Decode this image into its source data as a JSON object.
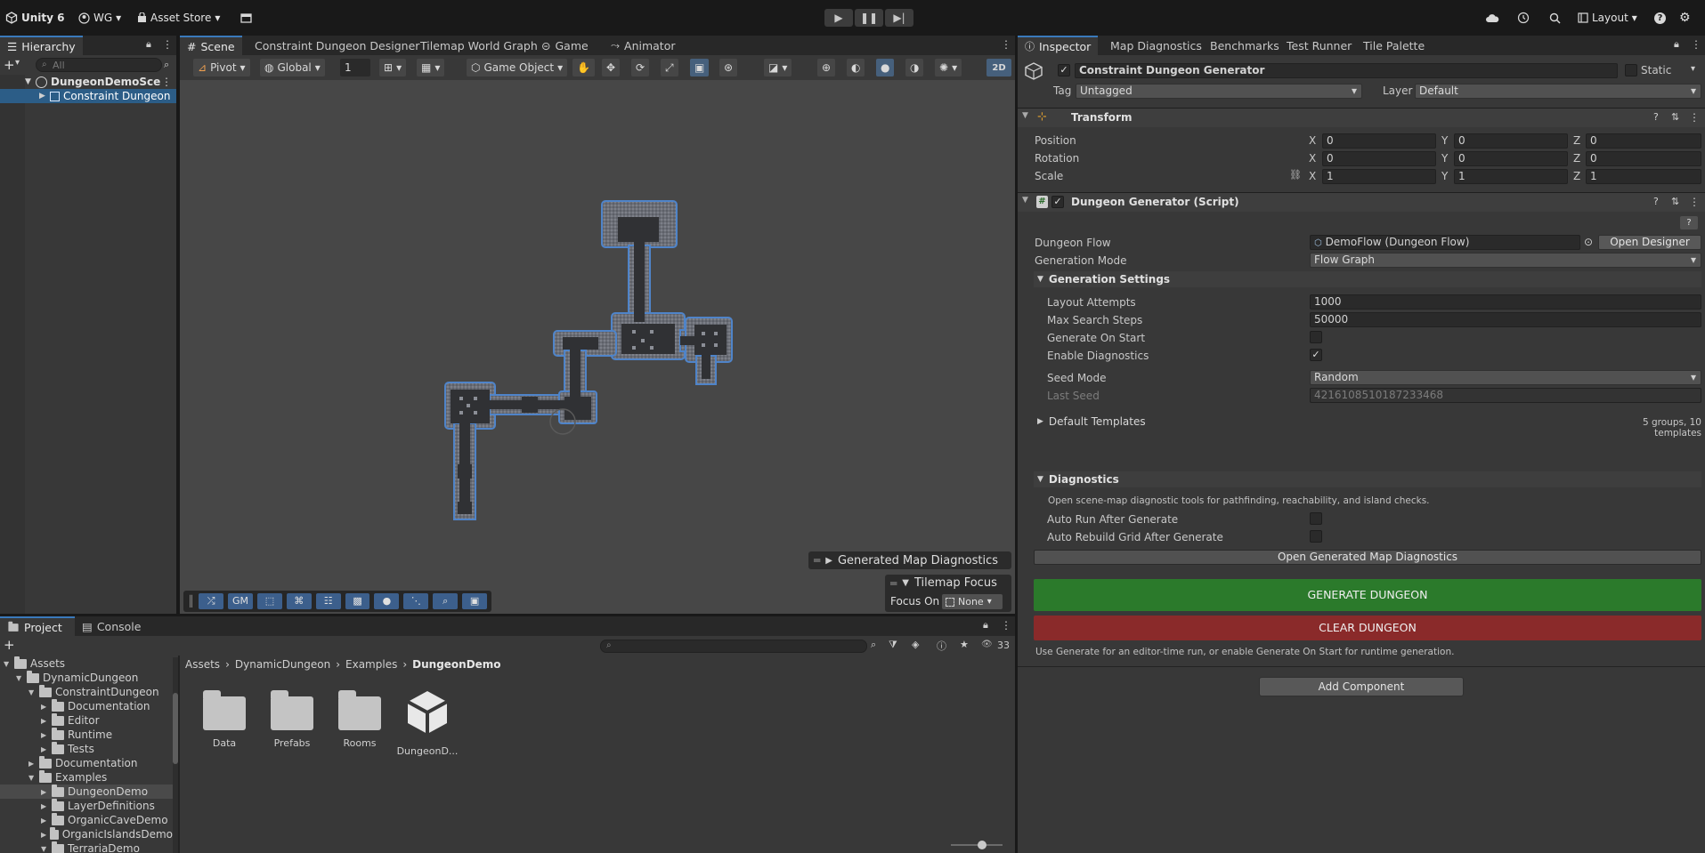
{
  "toolbar": {
    "app_name": "Unity 6",
    "account": "WG",
    "asset_store": "Asset Store",
    "layout": "Layout"
  },
  "hierarchy": {
    "tab": "Hierarchy",
    "search_placeholder": "All",
    "scene_name": "DungeonDemoScene",
    "object_name": "Constraint Dungeon G"
  },
  "scene": {
    "tabs": [
      "Scene",
      "Constraint Dungeon Designer",
      "Tilemap World Graph",
      "Game",
      "Animator"
    ],
    "pivot": "Pivot",
    "global": "Global",
    "grid_value": "1",
    "game_object": "Game Object",
    "mode_2d": "2D",
    "overlay_diagnostics": "Generated Map Diagnostics",
    "overlay_tilemap_focus": "Tilemap Focus",
    "focus_on_label": "Focus On",
    "focus_on_value": "None",
    "gm_label": "GM"
  },
  "inspector": {
    "tabs": [
      "Inspector",
      "Map Diagnostics",
      "Benchmarks",
      "Test Runner",
      "Tile Palette"
    ],
    "object_name": "Constraint Dungeon Generator",
    "static_label": "Static",
    "tag_label": "Tag",
    "tag_value": "Untagged",
    "layer_label": "Layer",
    "layer_value": "Default",
    "transform": {
      "title": "Transform",
      "position_label": "Position",
      "rotation_label": "Rotation",
      "scale_label": "Scale",
      "position": [
        "0",
        "0",
        "0"
      ],
      "rotation": [
        "0",
        "0",
        "0"
      ],
      "scale": [
        "1",
        "1",
        "1"
      ]
    },
    "script": {
      "title": "Dungeon Generator (Script)",
      "dungeon_flow_label": "Dungeon Flow",
      "dungeon_flow_value": "DemoFlow (Dungeon Flow)",
      "open_designer": "Open Designer",
      "generation_mode_label": "Generation Mode",
      "generation_mode_value": "Flow Graph",
      "generation_settings": "Generation Settings",
      "layout_attempts_label": "Layout Attempts",
      "layout_attempts_value": "1000",
      "max_search_label": "Max Search Steps",
      "max_search_value": "50000",
      "generate_on_start_label": "Generate On Start",
      "enable_diag_label": "Enable Diagnostics",
      "seed_mode_label": "Seed Mode",
      "seed_mode_value": "Random",
      "last_seed_label": "Last Seed",
      "last_seed_value": "4216108510187233468",
      "default_templates": "Default Templates",
      "templates_summary": "5 groups, 10 templates",
      "diagnostics": "Diagnostics",
      "diag_description": "Open scene-map diagnostic tools for pathfinding, reachability, and island checks.",
      "auto_run_label": "Auto Run After Generate",
      "auto_rebuild_label": "Auto Rebuild Grid After Generate",
      "open_diag_button": "Open Generated Map Diagnostics",
      "generate_button": "GENERATE DUNGEON",
      "clear_button": "CLEAR DUNGEON",
      "footer_hint": "Use Generate for an editor-time run, or enable Generate On Start for runtime generation."
    },
    "add_component": "Add Component"
  },
  "project": {
    "tabs": [
      "Project",
      "Console"
    ],
    "count": "33",
    "tree": [
      {
        "label": "Assets",
        "depth": 0,
        "open": true
      },
      {
        "label": "DynamicDungeon",
        "depth": 1,
        "open": true
      },
      {
        "label": "ConstraintDungeon",
        "depth": 2,
        "open": true
      },
      {
        "label": "Documentation",
        "depth": 3,
        "open": false
      },
      {
        "label": "Editor",
        "depth": 3,
        "open": false
      },
      {
        "label": "Runtime",
        "depth": 3,
        "open": false
      },
      {
        "label": "Tests",
        "depth": 3,
        "open": false
      },
      {
        "label": "Documentation",
        "depth": 2,
        "open": false
      },
      {
        "label": "Examples",
        "depth": 2,
        "open": true
      },
      {
        "label": "DungeonDemo",
        "depth": 3,
        "open": false
      },
      {
        "label": "LayerDefinitions",
        "depth": 3,
        "open": false
      },
      {
        "label": "OrganicCaveDemo",
        "depth": 3,
        "open": false
      },
      {
        "label": "OrganicIslandsDemo",
        "depth": 3,
        "open": false
      },
      {
        "label": "TerrariaDemo",
        "depth": 3,
        "open": true
      }
    ],
    "breadcrumb": [
      "Assets",
      "DynamicDungeon",
      "Examples",
      "DungeonDemo"
    ],
    "assets": [
      "Data",
      "Prefabs",
      "Rooms",
      "DungeonD..."
    ]
  },
  "colors": {
    "accent": "#3a79bb",
    "generate": "#2b7a2b",
    "clear": "#8a2a2a",
    "selected_row": "#2c5d87"
  }
}
